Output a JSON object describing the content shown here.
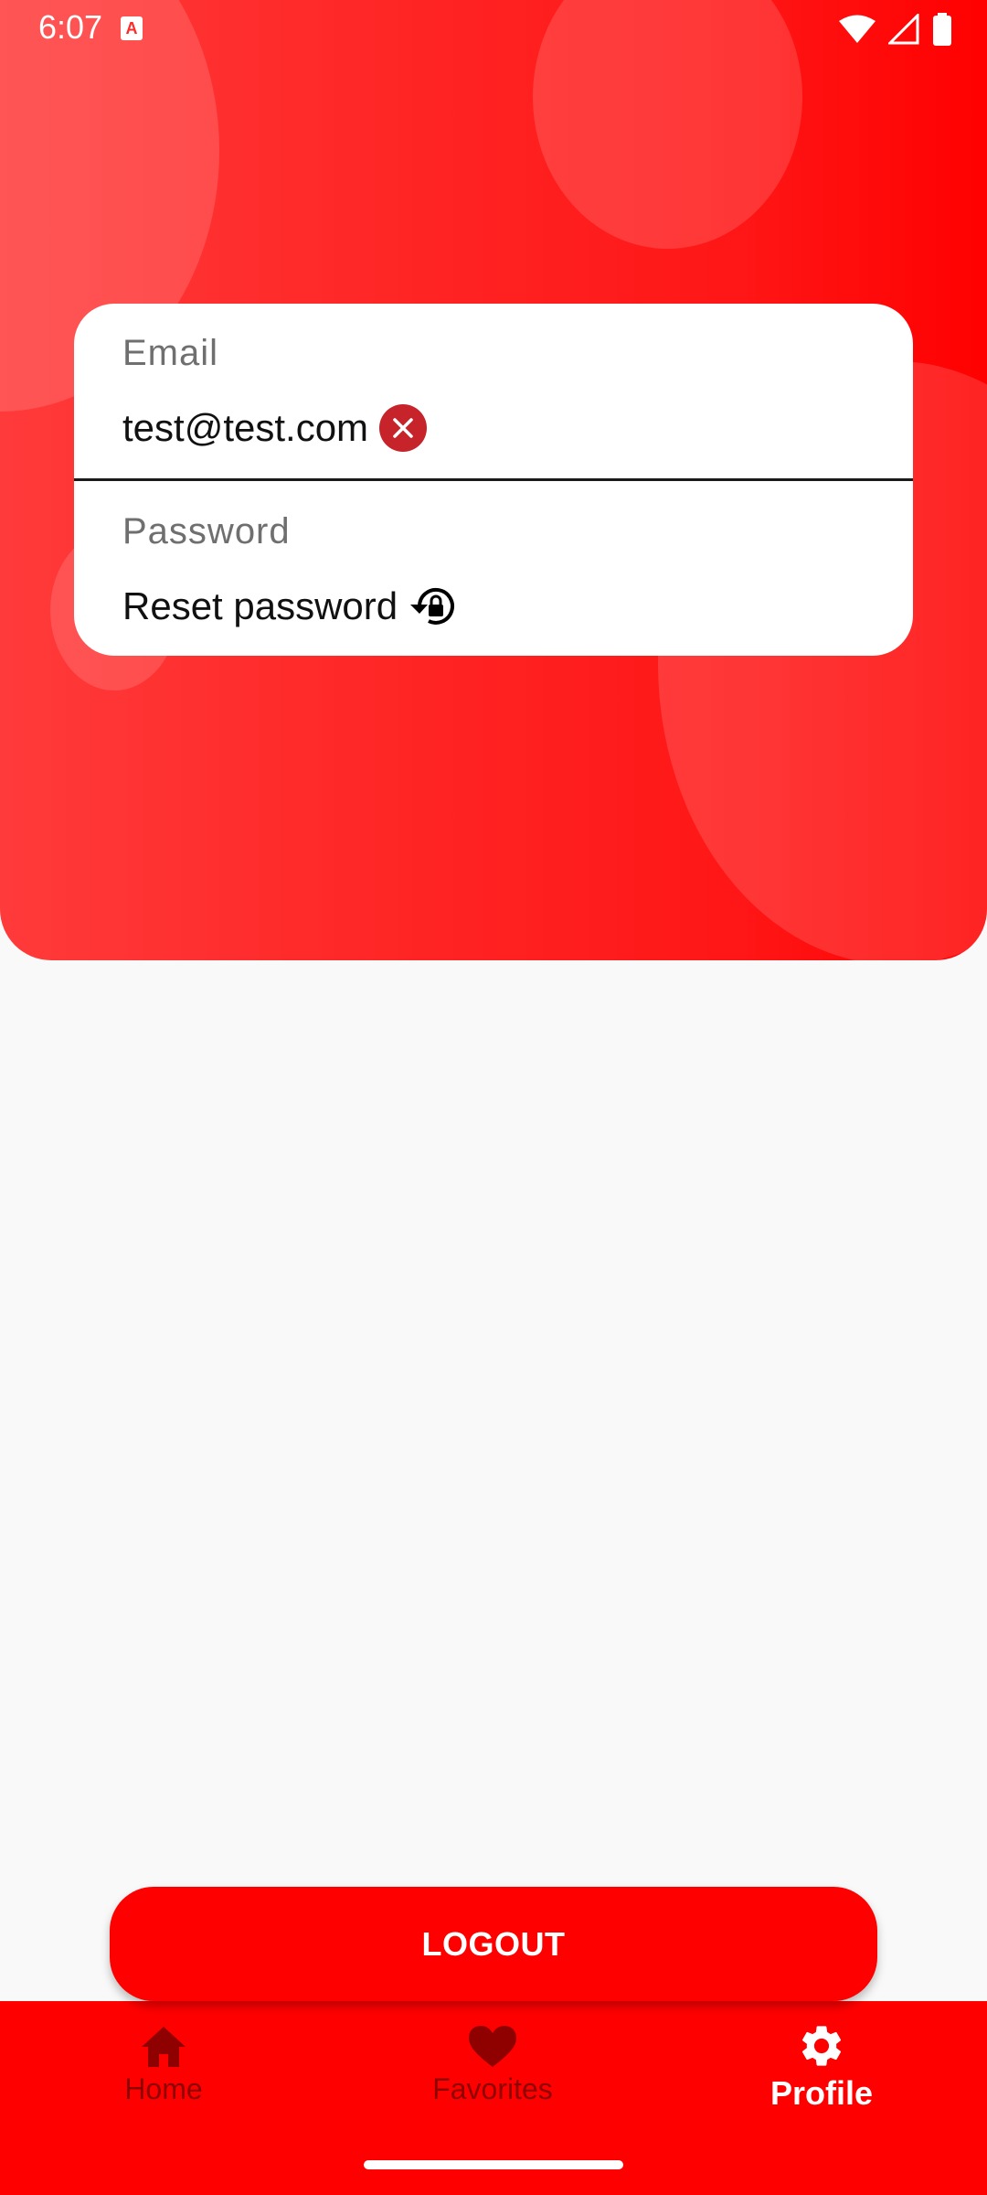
{
  "status_bar": {
    "time": "6:07",
    "notification_icon": "a-box-icon",
    "icons": [
      "wifi-icon",
      "cell-signal-icon",
      "battery-icon"
    ]
  },
  "form": {
    "email_label": "Email",
    "email_value": "test@test.com",
    "password_label": "Password",
    "reset_label": "Reset password"
  },
  "logout_label": "LOGOUT",
  "nav": {
    "items": [
      {
        "label": "Home",
        "icon": "home-icon",
        "active": false
      },
      {
        "label": "Favorites",
        "icon": "heart-icon",
        "active": false
      },
      {
        "label": "Profile",
        "icon": "gear-icon",
        "active": true
      }
    ]
  },
  "colors": {
    "primary": "#ff0000",
    "inactive_nav": "#8f0000",
    "clear_button": "#c6232b"
  }
}
